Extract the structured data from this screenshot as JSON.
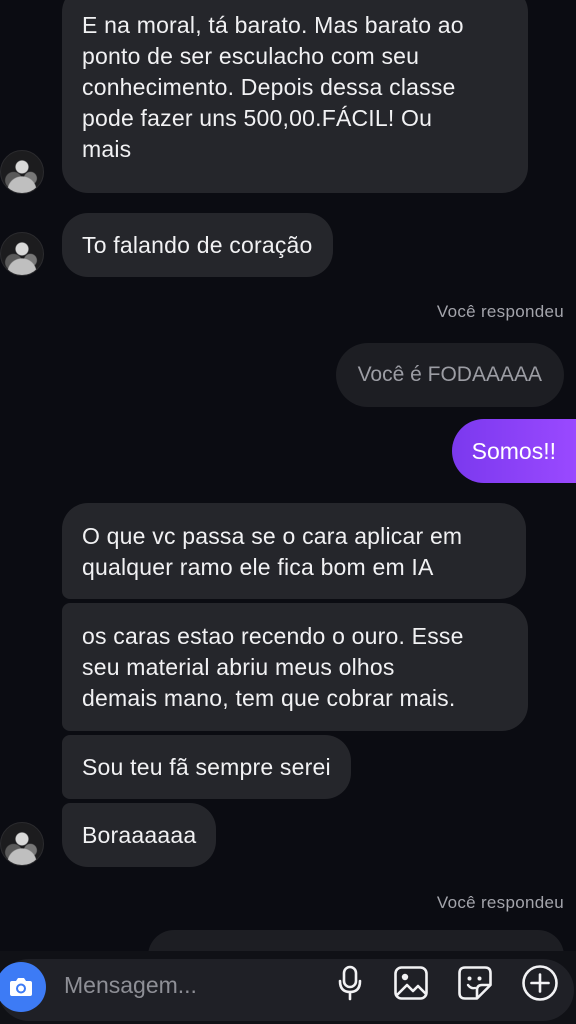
{
  "messages": {
    "m1": "E na moral, tá barato. Mas barato ao\nponto de ser esculacho com seu\nconhecimento. Depois dessa classe\npode fazer uns 500,00.FÁCIL! Ou\nmais",
    "m2": "To falando de coração",
    "reply_label_1": "Você respondeu",
    "quoted_1": "Você é FODAAAAA",
    "mine_1": "Somos!!",
    "m3": "O que vc passa se o cara aplicar em\nqualquer ramo ele fica bom em IA",
    "m4": "os caras estao recendo o ouro. Esse\nseu material abriu meus olhos\ndemais mano, tem que cobrar mais.",
    "m5": "Sou teu fã sempre serei",
    "m6": "Boraaaaaa",
    "reply_label_2": "Você respondeu"
  },
  "composer": {
    "placeholder": "Mensagem...",
    "icons": [
      "camera-icon",
      "microphone-icon",
      "gallery-icon",
      "sticker-icon",
      "plus-icon"
    ]
  },
  "colors": {
    "background": "#0b0c12",
    "incoming_bubble": "#25262b",
    "outgoing_bubble": "#8a42f8",
    "camera_button": "#3d7bf5"
  }
}
